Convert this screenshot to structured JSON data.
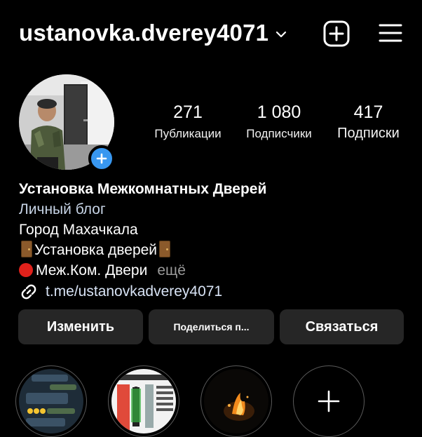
{
  "header": {
    "username": "ustanovka.dverey4071"
  },
  "stats": {
    "posts": {
      "value": "271",
      "label": "Публикации"
    },
    "followers": {
      "value": "1 080",
      "label": "Подписчики"
    },
    "following": {
      "value": "417",
      "label": "Подписки"
    }
  },
  "bio": {
    "name": "Установка Межкомнатных Дверей",
    "category": "Личный блог",
    "line1": "Город Махачкала",
    "line2": "Установка дверей",
    "line3": "Меж.Ком. Двери",
    "more": "ещё",
    "link": "t.me/ustanovkadverey4071"
  },
  "actions": {
    "edit": "Изменить",
    "share": "Поделиться п...",
    "contact": "Связаться"
  },
  "colors": {
    "background": "#000000",
    "button": "#262626",
    "accent": "#3897f0"
  },
  "icons": [
    "chevron-down-icon",
    "new-post-icon",
    "menu-icon",
    "add-story-icon",
    "link-icon",
    "door-emoji-icon",
    "red-circle-emoji-icon",
    "new-highlight-icon"
  ]
}
